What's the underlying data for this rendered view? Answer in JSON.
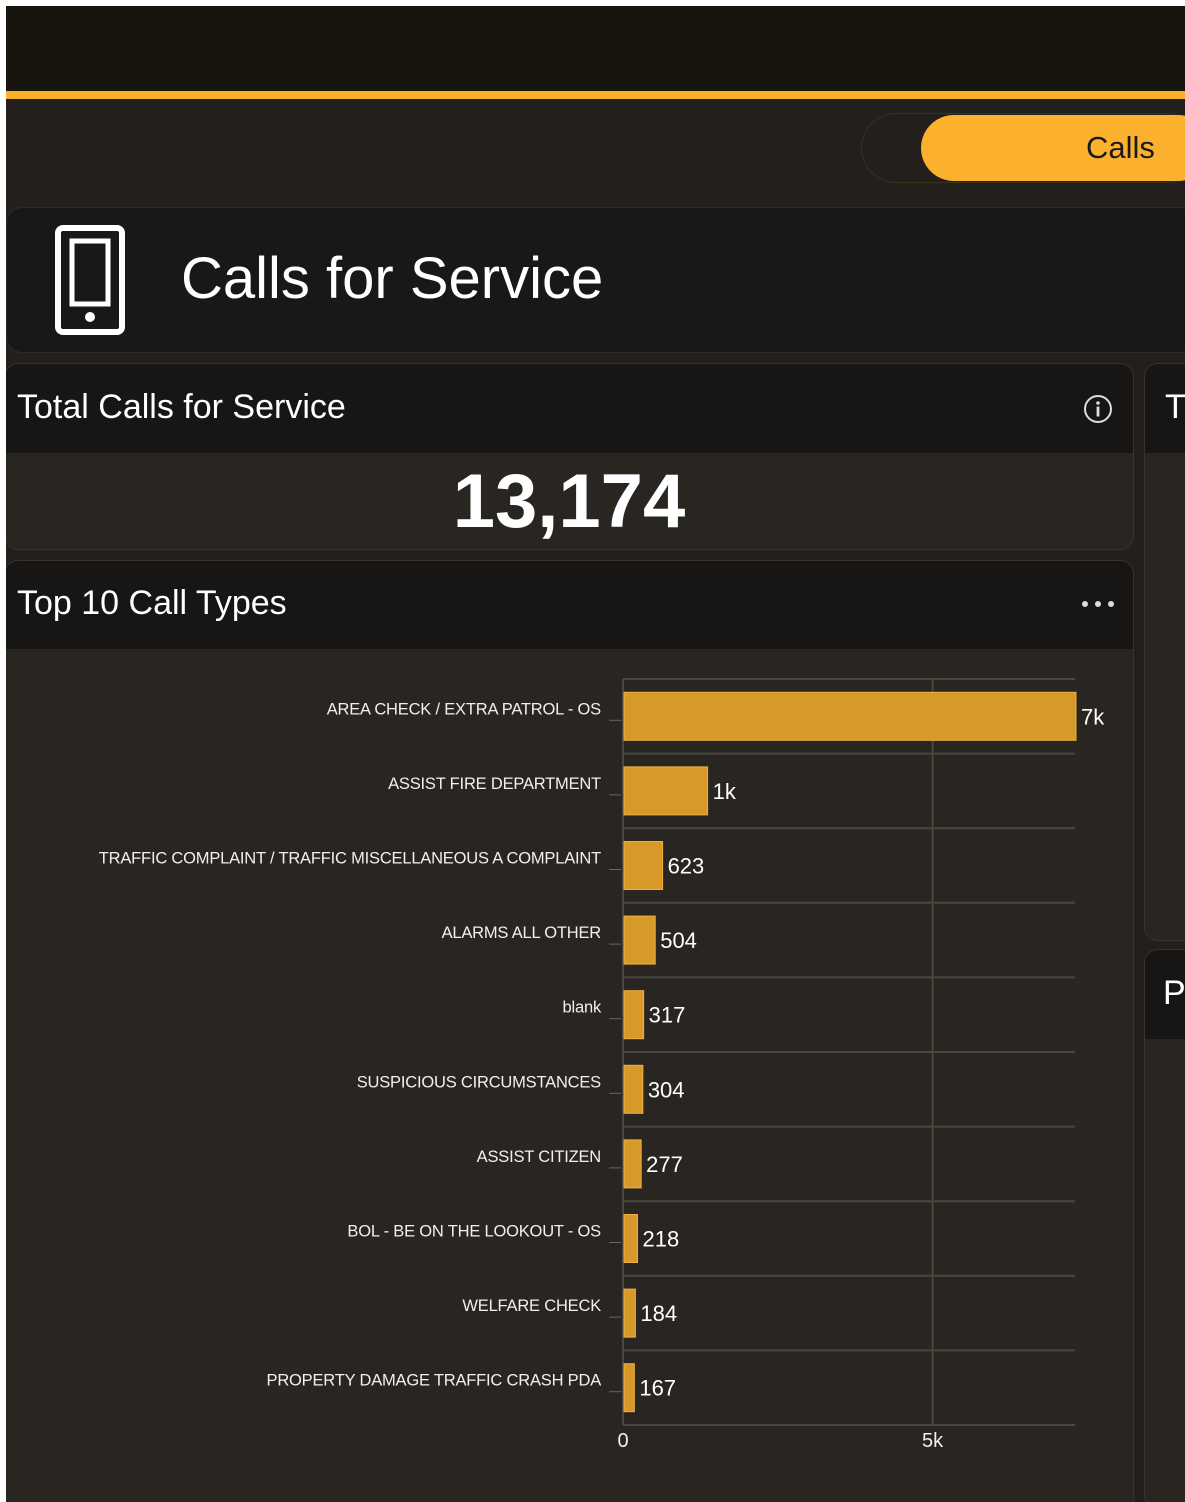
{
  "toggle": {
    "active_label": "Calls"
  },
  "header": {
    "title": "Calls for Service",
    "icon": "phone-icon"
  },
  "kpi_card": {
    "title": "Total Calls for Service",
    "value": "13,174"
  },
  "chart_card": {
    "title": "Top 10 Call Types"
  },
  "side_cards": [
    {
      "title_fragment": "T"
    },
    {
      "title_fragment": "P"
    }
  ],
  "colors": {
    "accent": "#fbb12e",
    "bar": "#d8992b",
    "background": "#221f1c",
    "card_header": "#181614"
  },
  "chart_data": {
    "type": "bar",
    "orientation": "horizontal",
    "title": "Top 10 Call Types",
    "categories": [
      "AREA CHECK / EXTRA PATROL - OS",
      "ASSIST FIRE DEPARTMENT",
      "TRAFFIC COMPLAINT / TRAFFIC MISCELLANEOUS A COMPLAINT",
      "ALARMS ALL OTHER",
      "blank",
      "SUSPICIOUS CIRCUMSTANCES",
      "ASSIST CITIZEN",
      "BOL - BE ON THE LOOKOUT - OS",
      "WELFARE CHECK",
      "PROPERTY DAMAGE TRAFFIC CRASH PDA"
    ],
    "values": [
      7300,
      1350,
      623,
      504,
      317,
      304,
      277,
      218,
      184,
      167
    ],
    "data_labels": [
      "7k",
      "1k",
      "623",
      "504",
      "317",
      "304",
      "277",
      "218",
      "184",
      "167"
    ],
    "x_ticks": [
      {
        "value": 0,
        "label": "0"
      },
      {
        "value": 5000,
        "label": "5k"
      }
    ],
    "xlim": [
      0,
      7300
    ],
    "grid": true
  }
}
